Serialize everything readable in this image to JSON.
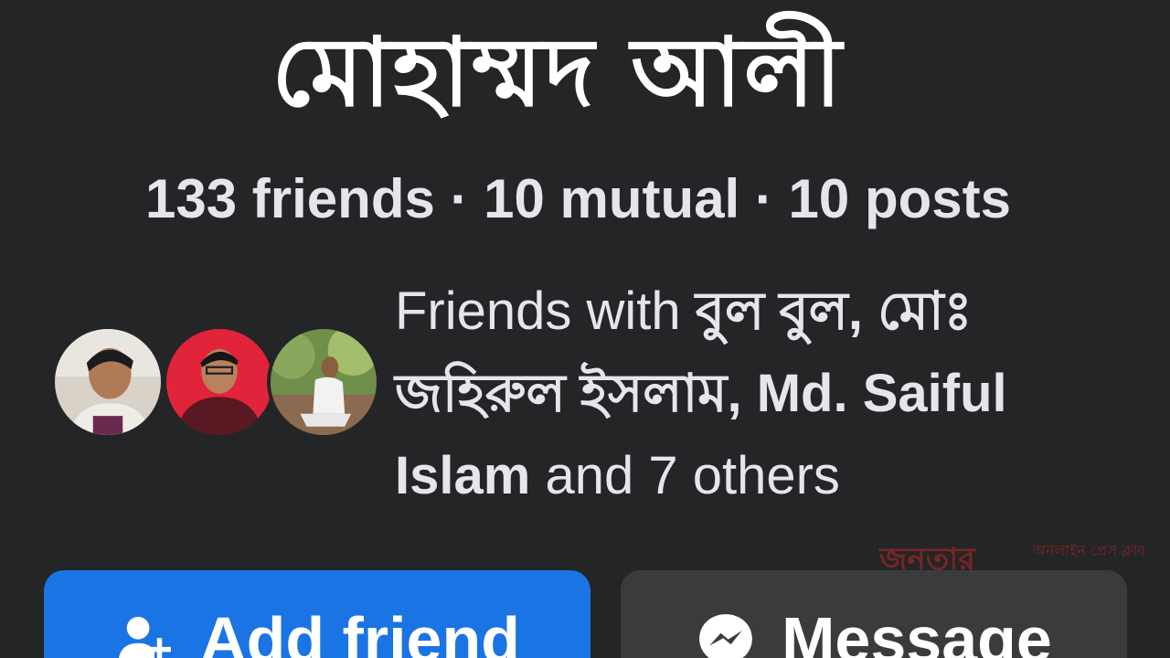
{
  "profile": {
    "name": "মোহাম্মদ  আলী",
    "stats": "133 friends · 10 mutual · 10 posts"
  },
  "mutual_friends": {
    "prefix": "Friends with ",
    "names": "বুল বুল, মোঃ জহিরুল ইসলাম, Md. Saiful Islam",
    "suffix": " and 7 others",
    "avatars": [
      {
        "icon": "person-avatar-1"
      },
      {
        "icon": "person-avatar-2"
      },
      {
        "icon": "person-avatar-3"
      }
    ]
  },
  "actions": {
    "add_friend_label": "Add friend",
    "add_friend_icon": "add-friend-icon",
    "message_label": "Message",
    "message_icon": "messenger-icon"
  },
  "watermark": {
    "main": "জনতার",
    "side": "অনলাইন প্রেস ক্লাব"
  },
  "colors": {
    "background": "#242526",
    "primary_button": "#1b74e4",
    "secondary_button": "#3a3b3c",
    "text": "#e4e6eb"
  }
}
